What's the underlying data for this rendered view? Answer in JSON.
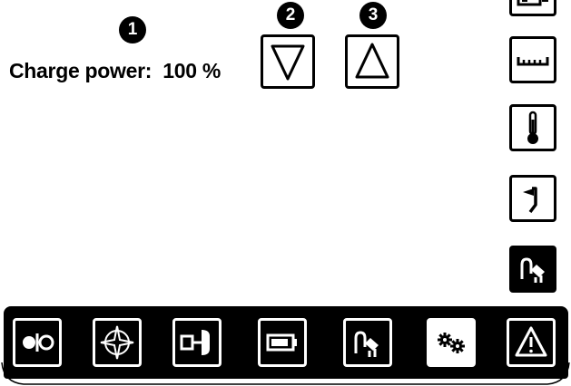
{
  "callouts": {
    "one": "1",
    "two": "2",
    "three": "3"
  },
  "charge_label": "Charge power:  100 %",
  "icons": {
    "down": "triangle-down-icon",
    "up": "triangle-up-icon",
    "side": [
      "display-icon",
      "ruler-icon",
      "thermometer-icon",
      "flag-icon",
      "charge-plug-icon"
    ],
    "tabs": [
      "drive-mode-icon",
      "compass-icon",
      "key-icon",
      "battery-icon",
      "charge-plug-icon",
      "settings-gears-icon",
      "warning-icon"
    ]
  },
  "colors": {
    "foreground": "#000000",
    "background": "#ffffff"
  },
  "active_tab": "settings-gears-icon"
}
